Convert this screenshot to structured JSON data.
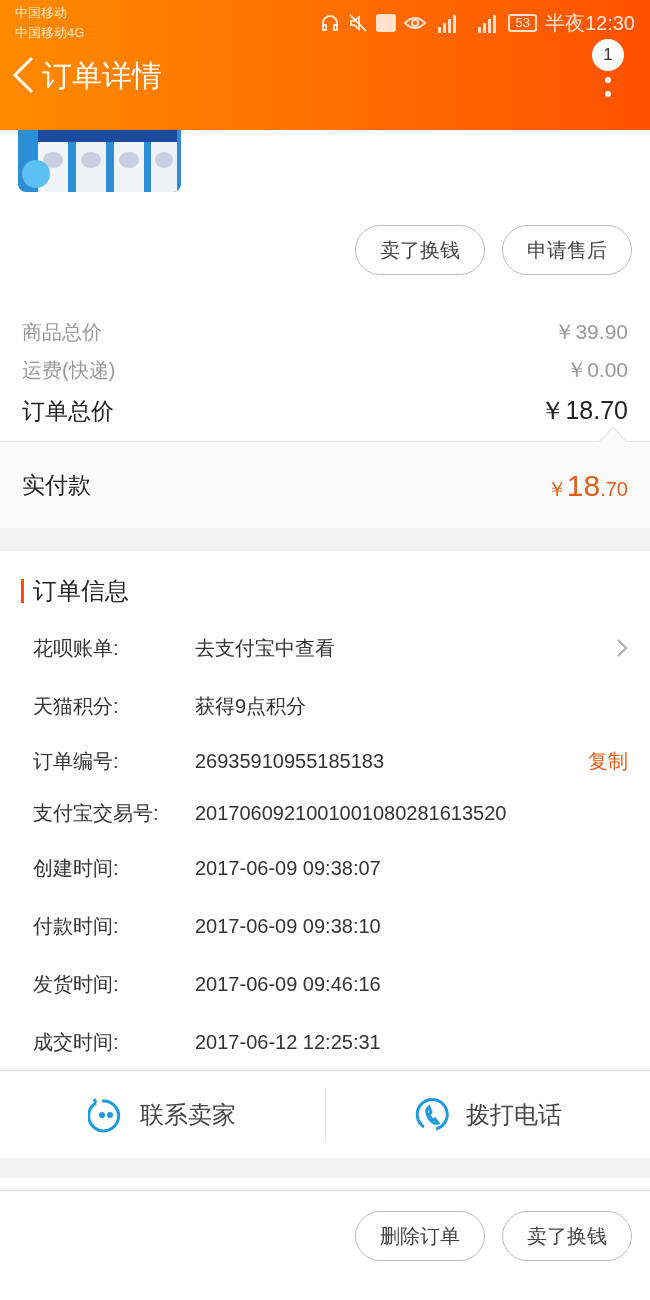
{
  "status_bar": {
    "carriers": [
      "中国移动",
      "中国移动4G"
    ],
    "battery": "53",
    "time": "半夜12:30"
  },
  "header": {
    "title": "订单详情",
    "badge": "1"
  },
  "product": {
    "kind": "picture"
  },
  "item_actions": [
    "卖了换钱",
    "申请售后"
  ],
  "price_rows": [
    {
      "kind": "minor",
      "label": "商品总价",
      "value": "￥39.90"
    },
    {
      "kind": "minor",
      "label": "运费(快递)",
      "value": "￥0.00"
    },
    {
      "kind": "total",
      "label": "订单总价",
      "value": "￥18.70"
    }
  ],
  "paid": {
    "label": "实付款",
    "currency": "￥",
    "integer": "18",
    "decimal": ".70"
  },
  "order_info": {
    "title": "订单信息",
    "rows": [
      {
        "kind": "link",
        "label": "花呗账单:",
        "value": "去支付宝中查看"
      },
      {
        "kind": "plain",
        "label": "天猫积分:",
        "value": "获得9点积分"
      },
      {
        "kind": "copy",
        "label": "订单编号:",
        "value": "26935910955185183",
        "action": "复制"
      },
      {
        "kind": "plain",
        "label": "支付宝交易号:",
        "value": "2017060921001001080281613520"
      },
      {
        "kind": "plain",
        "label": "创建时间:",
        "value": "2017-06-09 09:38:07"
      },
      {
        "kind": "plain",
        "label": "付款时间:",
        "value": "2017-06-09 09:38:10"
      },
      {
        "kind": "plain",
        "label": "发货时间:",
        "value": "2017-06-09 09:46:16"
      },
      {
        "kind": "plain",
        "label": "成交时间:",
        "value": "2017-06-12 12:25:31"
      }
    ]
  },
  "contact": [
    {
      "kind": "chat",
      "label": "联系卖家"
    },
    {
      "kind": "phone",
      "label": "拨打电话"
    }
  ],
  "bottom_actions": [
    "删除订单",
    "卖了换钱"
  ]
}
